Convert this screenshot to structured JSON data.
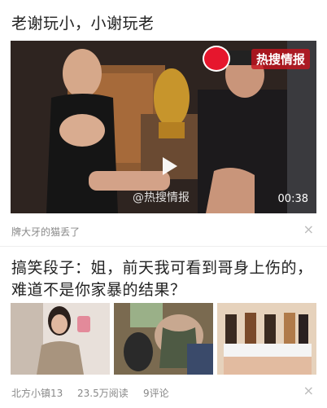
{
  "item1": {
    "title": "老谢玩小，小谢玩老",
    "video": {
      "duration": "00:38",
      "watermark_bottom": "@热搜情报",
      "watermark_top": "热搜情报"
    },
    "source": "牌大牙的猫丢了",
    "close_icon": "×"
  },
  "item2": {
    "title_line1": "搞笑段子：姐，前天我可看到哥身上伤的，",
    "title_line2": "难道不是你家暴的结果？",
    "source": "北方小镇13",
    "reads": "23.5万阅读",
    "comments": "9评论",
    "close_icon": "×"
  }
}
